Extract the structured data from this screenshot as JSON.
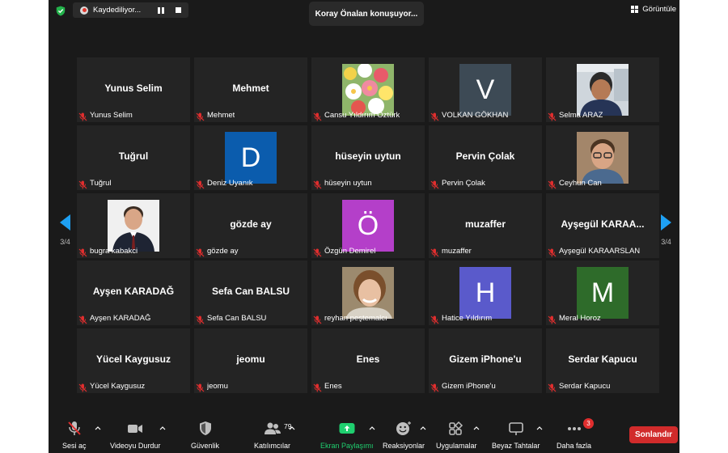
{
  "recording": {
    "label": "Kaydediliyor..."
  },
  "speaker": {
    "text": "Koray Önalan konuşuyor..."
  },
  "view": {
    "label": "Görüntüle"
  },
  "pager": {
    "left": "3/4",
    "right": "3/4"
  },
  "participants": [
    {
      "name": "Yunus Selim",
      "label": "Yunus Selim",
      "kind": "name"
    },
    {
      "name": "Mehmet",
      "label": "Mehmet",
      "kind": "name"
    },
    {
      "name": "",
      "label": "Cansu Yıldırım Öztürk",
      "kind": "photo",
      "photo": "flowers"
    },
    {
      "name": "",
      "label": "VOLKAN GÖKHAN",
      "kind": "avatar",
      "initial": "V",
      "color": "#3d4a55"
    },
    {
      "name": "",
      "label": "Selma ARAZ",
      "kind": "photo",
      "photo": "child"
    },
    {
      "name": "Tuğrul",
      "label": "Tuğrul",
      "kind": "name"
    },
    {
      "name": "",
      "label": "Deniz Uyanık",
      "kind": "avatar",
      "initial": "D",
      "color": "#0b5cad"
    },
    {
      "name": "hüseyin uytun",
      "label": "hüseyin uytun",
      "kind": "name"
    },
    {
      "name": "Pervin Çolak",
      "label": "Pervin Çolak",
      "kind": "name"
    },
    {
      "name": "",
      "label": "Ceyhun Can",
      "kind": "photo",
      "photo": "man-glasses"
    },
    {
      "name": "",
      "label": "bugra kabakci",
      "kind": "photo",
      "photo": "man-suit"
    },
    {
      "name": "gözde ay",
      "label": "gözde ay",
      "kind": "name"
    },
    {
      "name": "",
      "label": "Özgün Demirel",
      "kind": "avatar",
      "initial": "Ö",
      "color": "#b43fc9"
    },
    {
      "name": "muzaffer",
      "label": "muzaffer",
      "kind": "name"
    },
    {
      "name": "Ayşegül KARAA...",
      "label": "Ayşegül KARAARSLAN",
      "kind": "name"
    },
    {
      "name": "Ayşen KARADAĞ",
      "label": "Ayşen KARADAĞ",
      "kind": "name"
    },
    {
      "name": "Sefa Can BALSU",
      "label": "Sefa Can BALSU",
      "kind": "name"
    },
    {
      "name": "",
      "label": "reyhan peştemalcı",
      "kind": "photo",
      "photo": "woman"
    },
    {
      "name": "",
      "label": "Hatice Yıldırım",
      "kind": "avatar",
      "initial": "H",
      "color": "#5a5acb"
    },
    {
      "name": "",
      "label": "Meral Horoz",
      "kind": "avatar",
      "initial": "M",
      "color": "#2e6b2a"
    },
    {
      "name": "Yücel Kaygusuz",
      "label": "Yücel Kaygusuz",
      "kind": "name"
    },
    {
      "name": "jeomu",
      "label": "jeomu",
      "kind": "name"
    },
    {
      "name": "Enes",
      "label": "Enes",
      "kind": "name"
    },
    {
      "name": "Gizem iPhone'u",
      "label": "Gizem iPhone'u",
      "kind": "name"
    },
    {
      "name": "Serdar Kapucu",
      "label": "Serdar Kapucu",
      "kind": "name"
    }
  ],
  "toolbar": {
    "unmute": "Sesi aç",
    "video": "Videoyu Durdur",
    "security": "Güvenlik",
    "participants": "Katılımcılar",
    "participants_count": "79",
    "share": "Ekran Paylaşımı",
    "reactions": "Reaksiyonlar",
    "apps": "Uygulamalar",
    "whiteboards": "Beyaz Tahtalar",
    "more": "Daha fazla",
    "more_badge": "3",
    "end": "Sonlandır"
  },
  "colors": {
    "accent": "#1ea0f3",
    "share": "#1fcf6f",
    "end": "#d12b2b",
    "mute": "#e02e2e"
  }
}
